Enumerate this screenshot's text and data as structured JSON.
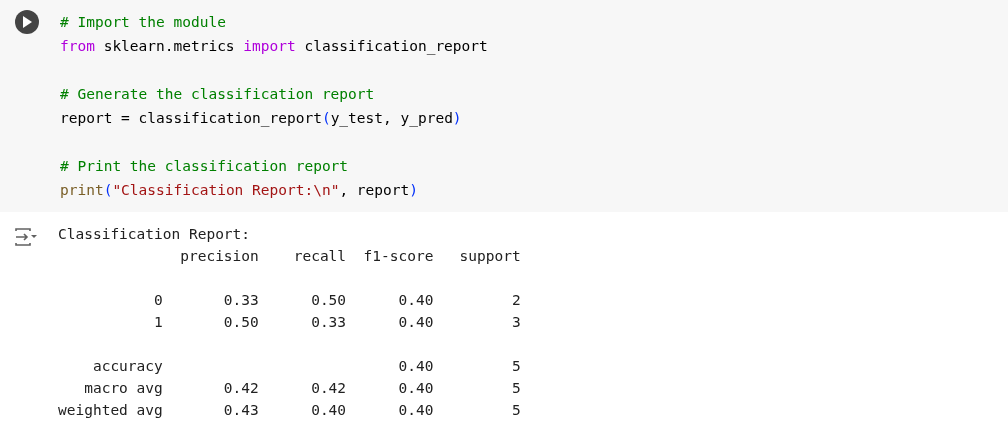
{
  "cell": {
    "blocks": [
      [
        {
          "tokens": [
            {
              "kind": "comment",
              "text": "# Import the module"
            }
          ]
        },
        {
          "tokens": [
            {
              "kind": "keyword",
              "text": "from"
            },
            {
              "kind": "plain",
              "text": " sklearn.metrics "
            },
            {
              "kind": "keyword",
              "text": "import"
            },
            {
              "kind": "plain",
              "text": " classification_report"
            }
          ]
        }
      ],
      [
        {
          "tokens": [
            {
              "kind": "comment",
              "text": "# Generate the classification report"
            }
          ]
        },
        {
          "tokens": [
            {
              "kind": "plain",
              "text": "report = classification_report"
            },
            {
              "kind": "paren",
              "text": "("
            },
            {
              "kind": "plain",
              "text": "y_test, y_pred"
            },
            {
              "kind": "paren",
              "text": ")"
            }
          ]
        }
      ],
      [
        {
          "tokens": [
            {
              "kind": "comment",
              "text": "# Print the classification report"
            }
          ]
        },
        {
          "tokens": [
            {
              "kind": "builtin",
              "text": "print"
            },
            {
              "kind": "paren",
              "text": "("
            },
            {
              "kind": "string",
              "text": "\"Classification Report:\\n\""
            },
            {
              "kind": "plain",
              "text": ", report"
            },
            {
              "kind": "paren",
              "text": ")"
            }
          ]
        }
      ]
    ]
  },
  "output": {
    "groups": [
      [
        "Classification Report:",
        "              precision    recall  f1-score   support"
      ],
      [
        "           0       0.33      0.50      0.40         2",
        "           1       0.50      0.33      0.40         3"
      ],
      [
        "    accuracy                           0.40         5",
        "   macro avg       0.42      0.42      0.40         5",
        "weighted avg       0.43      0.40      0.40         5"
      ]
    ]
  }
}
